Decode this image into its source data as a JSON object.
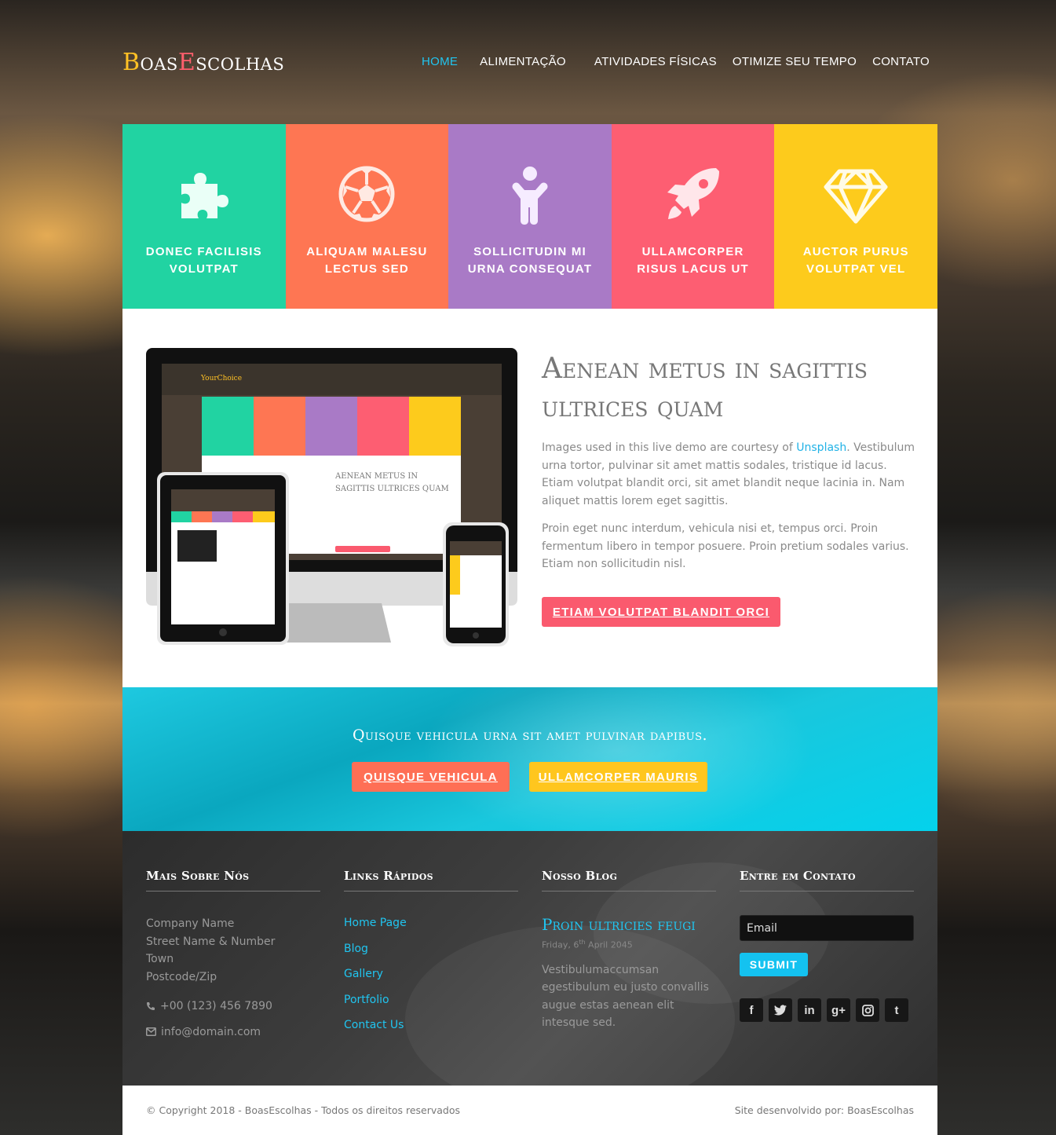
{
  "header": {
    "logo_part1": "B",
    "logo_part2": "oas",
    "logo_part3": "E",
    "logo_part4": "scolhas",
    "nav": [
      {
        "label": "HOME",
        "active": true
      },
      {
        "label": "ALIMENTAÇÃO",
        "active": false
      },
      {
        "label": "ATIVIDADES FÍSICAS",
        "active": false
      },
      {
        "label": "OTIMIZE SEU TEMPO",
        "active": false
      },
      {
        "label": "CONTATO",
        "active": false
      }
    ]
  },
  "features": [
    {
      "title": "DONEC FACILISIS VOLUTPAT",
      "icon": "puzzle-icon",
      "color": "#21d3a2"
    },
    {
      "title": "ALIQUAM MALESU LECTUS SED",
      "icon": "soccer-ball-icon",
      "color": "#fe7653"
    },
    {
      "title": "SOLLICITUDIN MI URNA CONSEQUAT",
      "icon": "person-icon",
      "color": "#a97ac6"
    },
    {
      "title": "ULLAMCORPER RISUS LACUS UT",
      "icon": "rocket-icon",
      "color": "#fd5e72"
    },
    {
      "title": "AUCTOR PURUS VOLUTPAT VEL",
      "icon": "diamond-icon",
      "color": "#fdcb1c"
    }
  ],
  "intro": {
    "heading": "Aenean metus in sagittis ultrices quam",
    "para1_prefix": "Images used in this live demo are courtesy of ",
    "para1_link": "Unsplash",
    "para1_suffix": ". Vestibulum urna tortor, pulvinar sit amet mattis sodales, tristique id lacus. Etiam volutpat blandit orci, sit amet blandit neque lacinia in. Nam aliquet mattis lorem eget sagittis.",
    "para2": "Proin eget nunc interdum, vehicula nisi et, tempus orci. Proin fermentum libero in tempor posuere. Proin pretium sodales varius. Etiam non sollicitudin nisl.",
    "button": "ETIAM VOLUTPAT BLANDIT ORCI"
  },
  "banner": {
    "heading": "Quisque vehicula urna sit amet pulvinar dapibus.",
    "button1": "QUISQUE VEHICULA",
    "button2": "ULLAMCORPER MAURIS"
  },
  "footer": {
    "about": {
      "title": "Mais Sobre Nós",
      "company": "Company Name",
      "street": "Street Name & Number",
      "town": "Town",
      "postcode": "Postcode/Zip",
      "phone": "+00 (123) 456 7890",
      "email": "info@domain.com"
    },
    "links": {
      "title": "Links Rápidos",
      "items": [
        "Home Page",
        "Blog",
        "Gallery",
        "Portfolio",
        "Contact Us"
      ]
    },
    "blog": {
      "title": "Nosso Blog",
      "post_title": "Proin ultricies feugi",
      "date_prefix": "Friday, 6",
      "date_sup": "th",
      "date_suffix": " April 2045",
      "excerpt": "Vestibulumaccumsan egestibulum eu justo convallis augue estas aenean elit intesque sed."
    },
    "contact": {
      "title": "Entre em Contato",
      "email_placeholder": "Email",
      "submit": "SUBMIT",
      "socials": [
        {
          "icon": "facebook-icon",
          "glyph": "f"
        },
        {
          "icon": "twitter-icon",
          "glyph": "t"
        },
        {
          "icon": "linkedin-icon",
          "glyph": "in"
        },
        {
          "icon": "google-plus-icon",
          "glyph": "g+"
        },
        {
          "icon": "instagram-icon",
          "glyph": ""
        },
        {
          "icon": "tumblr-icon",
          "glyph": "t"
        }
      ]
    }
  },
  "copyright": {
    "left": "© Copyright 2018 - BoasEscolhas - Todos os direitos reservados",
    "right": "Site desenvolvido por: BoasEscolhas"
  }
}
